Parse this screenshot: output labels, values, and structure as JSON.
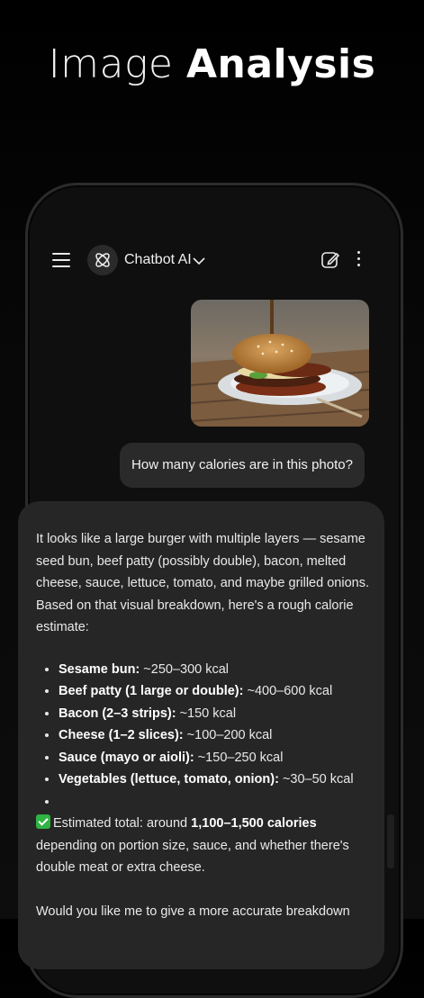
{
  "headline": {
    "light": "Image",
    "bold": "Analysis"
  },
  "header": {
    "bot_name": "Chatbot AI"
  },
  "user_message": "How many calories are in this photo?",
  "reply": {
    "intro": "It looks like a large burger with multiple layers — sesame seed bun, beef patty (possibly double), bacon, melted cheese, sauce, lettuce, tomato, and maybe grilled onions. Based on that visual breakdown, here's a rough calorie estimate:",
    "items": [
      {
        "label": "Sesame bun:",
        "value": "~250–300 kcal"
      },
      {
        "label": "Beef patty (1 large or double):",
        "value": "~400–600 kcal"
      },
      {
        "label": "Bacon (2–3 strips):",
        "value": "~150 kcal"
      },
      {
        "label": "Cheese (1–2 slices):",
        "value": "~100–200 kcal"
      },
      {
        "label": "Sauce (mayo or aioli):",
        "value": "~150–250 kcal"
      },
      {
        "label": "Vegetables (lettuce, tomato, onion):",
        "value": "~30–50 kcal"
      },
      {
        "label": "",
        "value": ""
      }
    ],
    "total_prefix": "Estimated total: around",
    "total_bold": "1,100–1,500 calories",
    "total_suffix": "depending on portion size, sauce, and whether there's double meat or extra cheese.",
    "followup": "Would you like me to give a more accurate breakdown"
  },
  "colors": {
    "accent_check": "#2fb344",
    "bubble": "#2a2a2a",
    "card": "#262626"
  }
}
